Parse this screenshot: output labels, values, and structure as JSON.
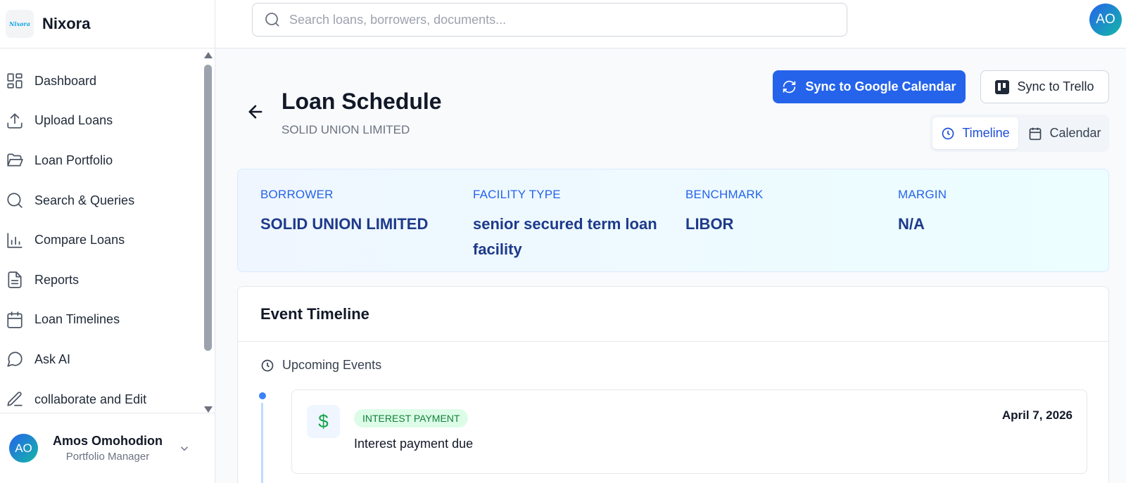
{
  "app": {
    "name": "Nixora",
    "logo_text": "Nixora"
  },
  "search": {
    "placeholder": "Search loans, borrowers, documents..."
  },
  "user": {
    "initials": "AO",
    "name": "Amos Omohodion",
    "role": "Portfolio Manager"
  },
  "sidebar": {
    "items": [
      {
        "label": "Dashboard",
        "icon": "dashboard-icon"
      },
      {
        "label": "Upload Loans",
        "icon": "upload-icon"
      },
      {
        "label": "Loan Portfolio",
        "icon": "folder-open-icon"
      },
      {
        "label": "Search & Queries",
        "icon": "search-icon"
      },
      {
        "label": "Compare Loans",
        "icon": "bar-chart-icon"
      },
      {
        "label": "Reports",
        "icon": "document-icon"
      },
      {
        "label": "Loan Timelines",
        "icon": "calendar-icon"
      },
      {
        "label": "Ask AI",
        "icon": "chat-bubble-icon"
      },
      {
        "label": "collaborate and Edit",
        "icon": "pencil-icon"
      }
    ]
  },
  "page": {
    "title": "Loan Schedule",
    "subtitle": "SOLID UNION LIMITED",
    "sync_google_label": "Sync to Google Calendar",
    "sync_trello_label": "Sync to Trello",
    "view_toggle": {
      "timeline": "Timeline",
      "calendar": "Calendar",
      "active": "Timeline"
    }
  },
  "loan_info": {
    "borrower_label": "BORROWER",
    "borrower": "SOLID UNION LIMITED",
    "facility_label": "FACILITY TYPE",
    "facility": "senior secured term loan facility",
    "benchmark_label": "BENCHMARK",
    "benchmark": "LIBOR",
    "margin_label": "MARGIN",
    "margin": "N/A"
  },
  "timeline": {
    "heading": "Event Timeline",
    "section": "Upcoming Events",
    "events": [
      {
        "badge": "INTEREST PAYMENT",
        "title": "Interest payment due",
        "date": "April 7, 2026",
        "icon": "dollar-icon"
      }
    ]
  },
  "colors": {
    "primary": "#2563eb",
    "badge_green_bg": "#dcfce7",
    "badge_green_text": "#15803d",
    "info_label": "#2563eb",
    "info_value": "#1e3a8a"
  }
}
